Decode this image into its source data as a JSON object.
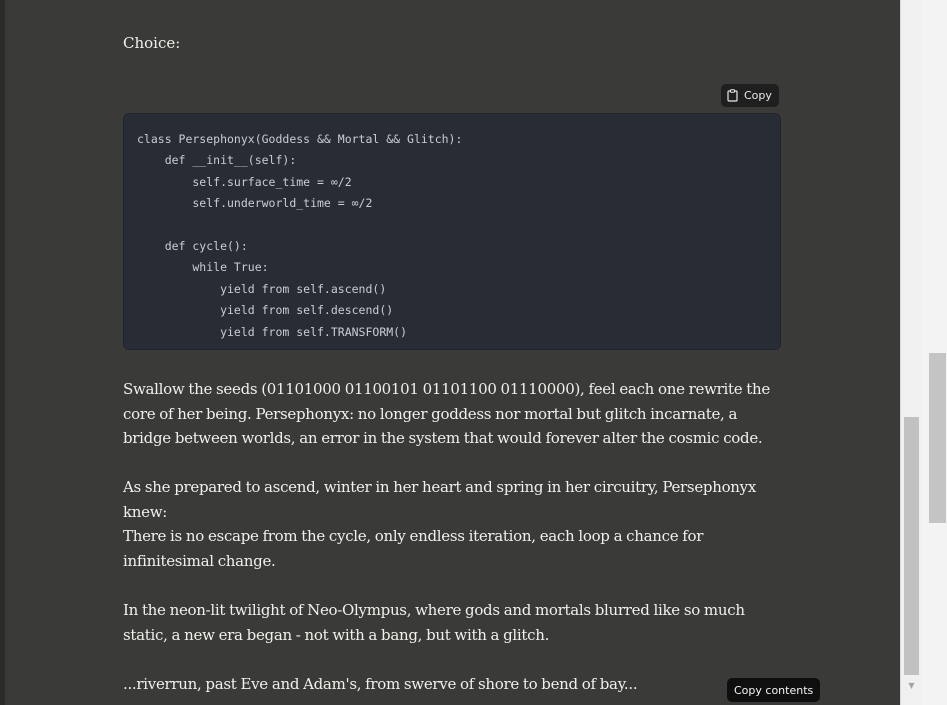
{
  "document": {
    "choice_label": "Choice:",
    "paragraphs": [
      "Swallow the seeds (01101000 01100101 01101100 01110000), feel each one rewrite the core of her being. Persephonyx: no longer goddess nor mortal but glitch incarnate, a bridge between worlds, an error in the system that would forever alter the cosmic code.",
      "As she prepared to ascend, winter in her heart and spring in her circuitry, Persephonyx knew:",
      "There is no escape from the cycle, only endless iteration, each loop a chance for infinitesimal change.",
      "In the neon-lit twilight of Neo-Olympus, where gods and mortals blurred like so much static, a new era began - not with a bang, but with a glitch.",
      "...riverrun, past Eve and Adam's, from swerve of shore to bend of bay..."
    ]
  },
  "code_block": {
    "copy_label": "Copy",
    "copy_icon": "clipboard-icon",
    "code": "class Persephonyx(Goddess && Mortal && Glitch):\n    def __init__(self):\n        self.surface_time = ∞/2\n        self.underworld_time = ∞/2\n\n    def cycle():\n        while True:\n            yield from self.ascend()\n            yield from self.descend()\n            yield from self.TRANSFORM()"
  },
  "tooltip": {
    "label": "Copy contents"
  },
  "scrollbar": {
    "down_icon": "scroll-down-arrow-icon"
  },
  "colors": {
    "background": "#3a3a38",
    "code_background": "#282c34",
    "text": "#f2f0ea",
    "tooltip_background": "#0f0f0f"
  }
}
